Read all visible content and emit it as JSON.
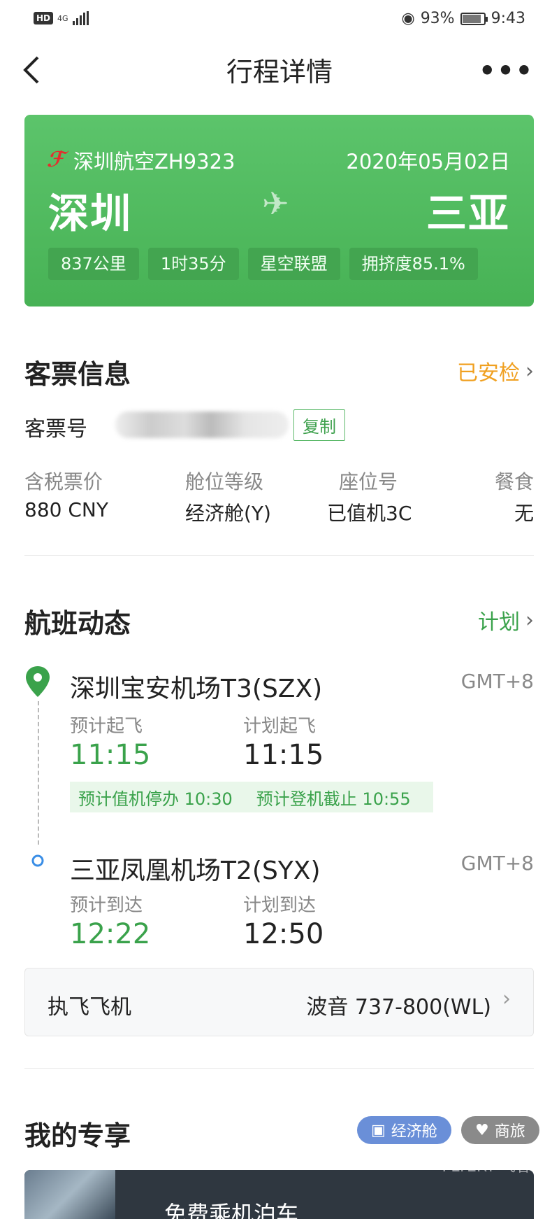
{
  "statusbar": {
    "hd": "HD",
    "network": "4G",
    "battery": "93%",
    "time": "9:43",
    "battery_level": 0.93
  },
  "nav": {
    "back_icon": "chevron-left-icon",
    "title": "行程详情",
    "more_icon": "more-dots-icon",
    "more_glyph": "•••"
  },
  "flight": {
    "airline": "深圳航空ZH9323",
    "date": "2020年05月02日",
    "from": "深圳",
    "to": "三亚",
    "tags": [
      "837公里",
      "1时35分",
      "星空联盟",
      "拥挤度85.1%"
    ]
  },
  "ticket": {
    "title": "客票信息",
    "status": "已安检",
    "number_label": "客票号",
    "copy": "复制",
    "columns": [
      {
        "label": "含税票价",
        "value": "880 CNY"
      },
      {
        "label": "舱位等级",
        "value": "经济舱(Y)"
      },
      {
        "label": "座位号",
        "value": "已值机3C"
      },
      {
        "label": "餐食",
        "value": "无"
      }
    ]
  },
  "dynamic": {
    "title": "航班动态",
    "link": "计划",
    "departure": {
      "airport": "深圳宝安机场T3(SZX)",
      "gmt": "GMT+8",
      "est_label": "预计起飞",
      "est_time": "11:15",
      "plan_label": "计划起飞",
      "plan_time": "11:15"
    },
    "notice": {
      "checkin": "预计值机停办 10:30",
      "boarding": "预计登机截止 10:55"
    },
    "arrival": {
      "airport": "三亚凤凰机场T2(SYX)",
      "gmt": "GMT+8",
      "est_label": "预计到达",
      "est_time": "12:22",
      "plan_label": "计划到达",
      "plan_time": "12:50"
    }
  },
  "aircraft": {
    "label": "执飞飞机",
    "value": "波音 737-800(WL)"
  },
  "exclusive": {
    "title": "我的专享",
    "pill1": "经济舱",
    "pill2": "商旅",
    "pill1_color": "#6a8fd8",
    "pill2_color": "#8a8a8a",
    "banner_text": "免费乘机泊车"
  },
  "watermark": "FLYERT 飞客",
  "colors": {
    "accent_green": "#3aa24b",
    "status_orange": "#f0a020",
    "card_green": "#4fb85d"
  }
}
